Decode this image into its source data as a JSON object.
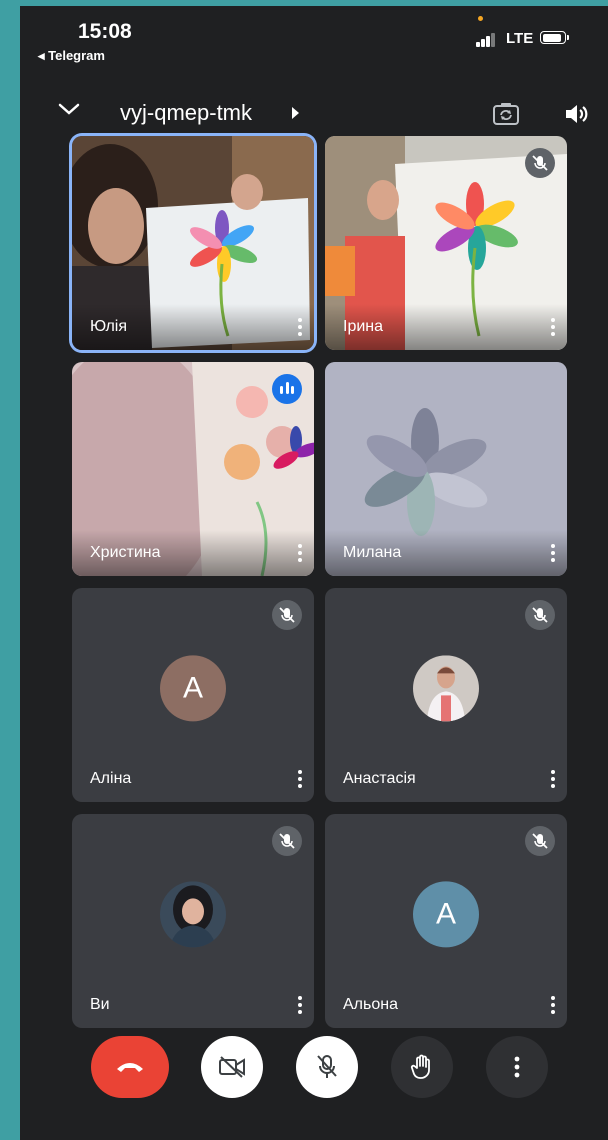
{
  "status_bar": {
    "time": "15:08",
    "back_app": "◂ Telegram",
    "network": "LTE"
  },
  "header": {
    "meeting_code": "vyj-qmep-tmk"
  },
  "participants": [
    {
      "name": "Юлія",
      "state": "active-speaker-pinned",
      "video": true
    },
    {
      "name": "Ірина",
      "state": "muted",
      "video": true
    },
    {
      "name": "Христина",
      "state": "speaking",
      "video": true
    },
    {
      "name": "Милана",
      "state": "unmuted",
      "video": true
    },
    {
      "name": "Аліна",
      "state": "muted",
      "video": false,
      "avatar_letter": "A",
      "avatar_color": "#8d6e63"
    },
    {
      "name": "Анастасія",
      "state": "muted",
      "video": false,
      "avatar": "photo"
    },
    {
      "name": "Ви",
      "state": "muted",
      "video": false,
      "avatar": "photo"
    },
    {
      "name": "Альона",
      "state": "muted",
      "video": false,
      "avatar_letter": "A",
      "avatar_color": "#5f8fa8"
    }
  ],
  "controls": [
    {
      "icon": "end-call-icon",
      "color": "#ea4335"
    },
    {
      "icon": "camera-off-icon",
      "color": "#ffffff"
    },
    {
      "icon": "mic-off-icon",
      "color": "#ffffff"
    },
    {
      "icon": "raise-hand-icon",
      "color": "#3c4043"
    },
    {
      "icon": "more-options-icon",
      "color": "#3c4043"
    }
  ],
  "colors": {
    "background": "#1f2022",
    "tile": "#3b3d42",
    "active_border": "#8ab4f8",
    "speaking": "#1a73e8",
    "end_call": "#ea4335"
  }
}
